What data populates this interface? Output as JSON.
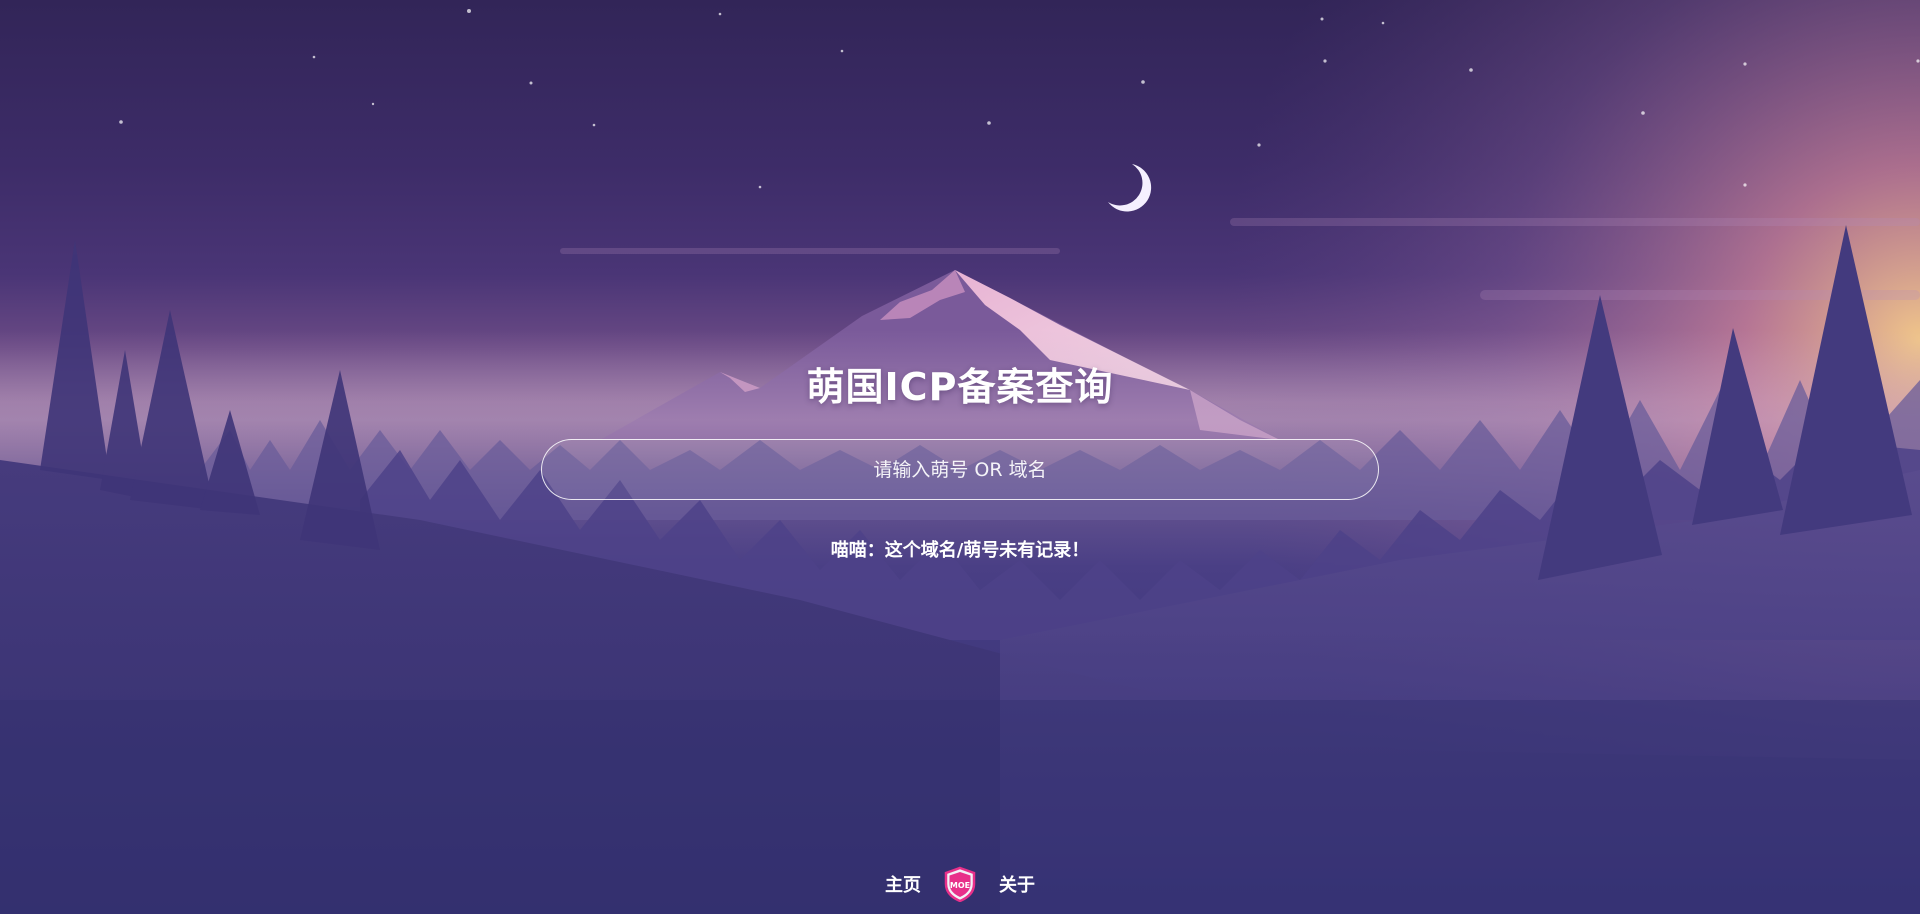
{
  "page": {
    "title": "萌国ICP备案查询"
  },
  "search": {
    "placeholder": "请输入萌号 OR 域名",
    "value": ""
  },
  "result": {
    "message": "喵喵：这个域名/萌号未有记录！"
  },
  "footer": {
    "home_label": "主页",
    "about_label": "关于",
    "logo_icon": "moe-shield-logo-icon",
    "logo_text": "MOE"
  },
  "colors": {
    "accent": "#e8308a",
    "text": "#ffffff",
    "sky_top": "#322558",
    "horizon_glow": "#f3c48e"
  }
}
